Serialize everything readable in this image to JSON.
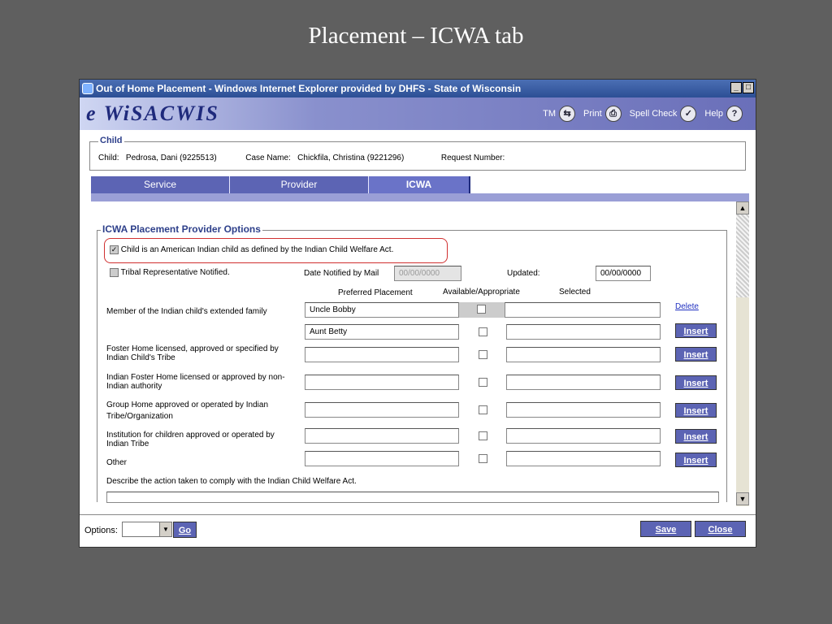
{
  "slide_title": "Placement – ICWA tab",
  "window": {
    "title": "Out of Home Placement - Windows Internet Explorer provided by DHFS - State of Wisconsin",
    "min": "_",
    "max": "□"
  },
  "banner": {
    "brand": "e WiSACWIS",
    "tools": [
      {
        "label": "TM",
        "icon": "tm-icon",
        "glyph": "⇆"
      },
      {
        "label": "Print",
        "icon": "print-icon",
        "glyph": "⎙"
      },
      {
        "label": "Spell Check",
        "icon": "spell-check-icon",
        "glyph": "✓"
      },
      {
        "label": "Help",
        "icon": "help-icon",
        "glyph": "?"
      }
    ]
  },
  "child": {
    "legend": "Child",
    "child_label": "Child:",
    "child_value": "Pedrosa, Dani (9225513)",
    "case_label": "Case Name:",
    "case_value": "Chickfila, Christina (9221296)",
    "request_label": "Request Number:"
  },
  "tabs": [
    {
      "label": "Service"
    },
    {
      "label": "Provider"
    },
    {
      "label": "ICWA"
    }
  ],
  "icwa": {
    "legend": "ICWA Placement Provider Options",
    "american_indian_label": "Child is an American Indian child as defined by the Indian Child Welfare Act.",
    "tribal_label": "Tribal Representative Notified.",
    "date_mail_label": "Date Notified by Mail",
    "date_mail_value": "00/00/0000",
    "updated_label": "Updated:",
    "updated_value": "00/00/0000",
    "col_preferred": "Preferred Placement",
    "col_available": "Available/Appropriate",
    "col_selected": "Selected",
    "rows": [
      {
        "label": "Member of the Indian child's extended family",
        "preferred": "Uncle Bobby",
        "action": "Delete"
      },
      {
        "label": "",
        "preferred": "Aunt Betty",
        "action": "Insert"
      },
      {
        "label": "Foster Home licensed, approved or specified by Indian Child's Tribe",
        "preferred": "",
        "action": "Insert"
      },
      {
        "label": "Indian Foster Home licensed or approved by non-Indian authority",
        "preferred": "",
        "action": "Insert"
      },
      {
        "label": "Group Home approved or operated by Indian Tribe/Organization",
        "preferred": "",
        "action": "Insert"
      },
      {
        "label": "Institution for children approved or operated by Indian Tribe",
        "preferred": "",
        "action": "Insert"
      },
      {
        "label": "Other",
        "preferred": "",
        "action": "Insert"
      }
    ],
    "describe_label": "Describe the action taken to comply with the Indian Child Welfare Act."
  },
  "footer": {
    "options_label": "Options:",
    "go_label": "Go",
    "save_label": "Save",
    "close_label": "Close"
  }
}
